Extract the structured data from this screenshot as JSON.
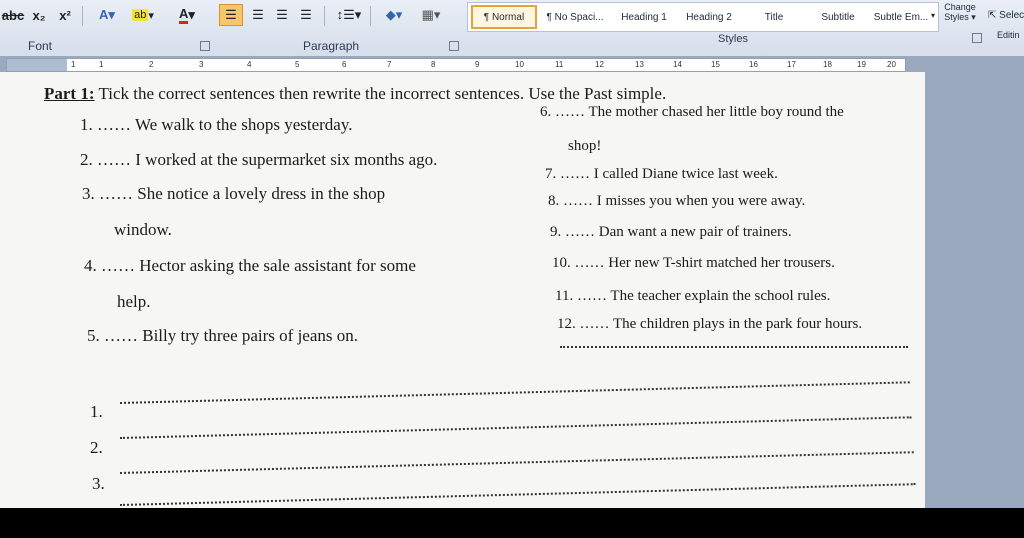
{
  "ribbon": {
    "font_group": {
      "strikethrough": "abc",
      "subscript": "x₂",
      "superscript": "x²",
      "label": "Font"
    },
    "paragraph_group": {
      "label": "Paragraph"
    },
    "styles_group": {
      "label": "Styles",
      "items": [
        {
          "label": "¶ Normal",
          "active": true
        },
        {
          "label": "¶ No Spaci..."
        },
        {
          "label": "Heading 1"
        },
        {
          "label": "Heading 2"
        },
        {
          "label": "Title"
        },
        {
          "label": "Subtitle"
        },
        {
          "label": "Subtle Em..."
        }
      ],
      "change_styles": "Change Styles"
    },
    "editing_group": {
      "select": "Selec",
      "label": "Editin"
    }
  },
  "ruler": {
    "numbers": [
      "1",
      "1",
      "2",
      "3",
      "4",
      "5",
      "6",
      "7",
      "8",
      "9",
      "10",
      "11",
      "12",
      "13",
      "14",
      "15",
      "16",
      "17",
      "18",
      "19",
      "20"
    ]
  },
  "document": {
    "title_label": "Part 1:",
    "title_text": " Tick the correct sentences then rewrite the incorrect sentences. Use the Past simple.",
    "left": {
      "s1": "1.   …… We walk to the shops yesterday.",
      "s2": "2.   …… I worked at the supermarket six months ago.",
      "s3": "3.   …… She notice a lovely dress in the shop",
      "s3b": "window.",
      "s4": "4.   …… Hector asking the sale assistant for some",
      "s4b": "help.",
      "s5": "5.   …… Billy try three pairs of jeans on."
    },
    "right": {
      "s6": "6.   …… The mother chased her little boy round the",
      "s6b": "shop!",
      "s7": "7.   …… I called Diane twice last week.",
      "s8": "8.   …… I misses you when you were away.",
      "s9": "9.   …… Dan want a new pair of trainers.",
      "s10": "10. …… Her new T-shirt matched her trousers.",
      "s11": "11. …… The teacher explain the school rules.",
      "s12": "12. …… The children plays in the park four hours."
    },
    "answers": [
      "1.",
      "2.",
      "3."
    ]
  },
  "colors": {
    "accent": "#e6a23c",
    "ribbon": "#dfe6f0",
    "workspace": "#9aa9bd"
  }
}
